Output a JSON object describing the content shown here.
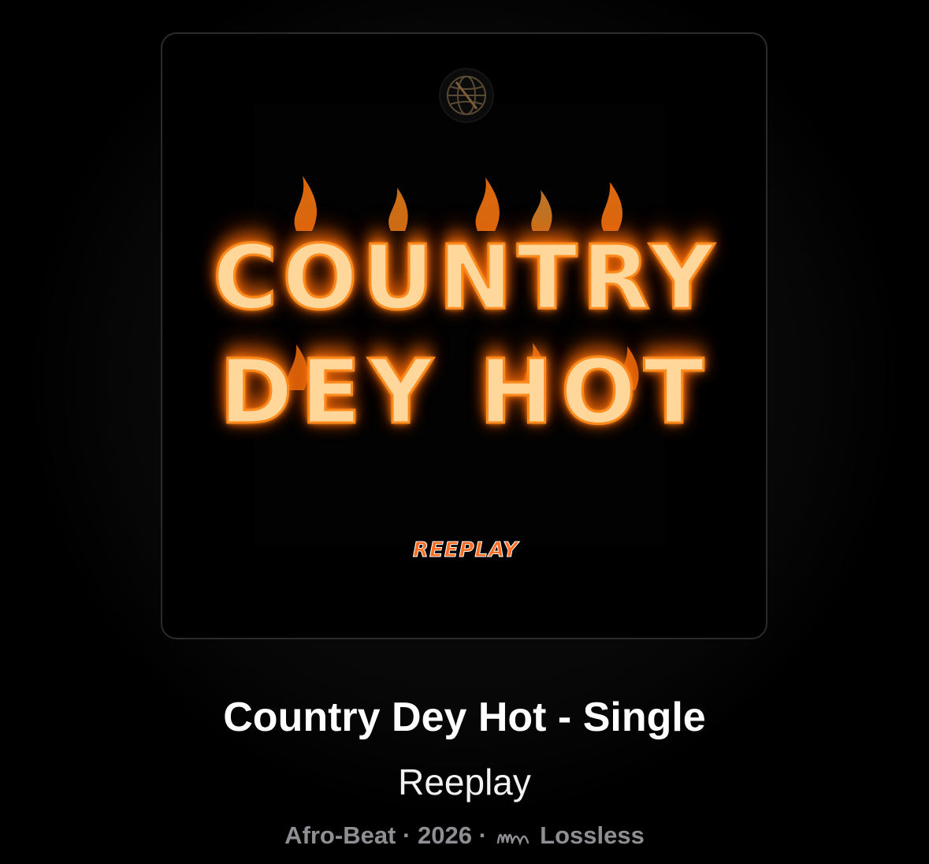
{
  "artwork": {
    "cover_line_1": "COUNTRY",
    "cover_line_2": "DEY HOT",
    "cover_artist": "REEPLAY",
    "logo_icon": "globe-icon",
    "colors": {
      "flame": "#ff8a1c",
      "flame_text": "#ffd79a",
      "badge": "#ff6a1f"
    }
  },
  "album": {
    "title": "Country Dey Hot - Single",
    "artist": "Reeplay",
    "genre": "Afro-Beat",
    "separator_1": "·",
    "year": "2026",
    "separator_2": "·",
    "quality_icon": "lossless-waveform-icon",
    "quality": "Lossless"
  },
  "colors": {
    "background": "#000000",
    "title": "#ffffff",
    "meta": "#8e8e93"
  }
}
